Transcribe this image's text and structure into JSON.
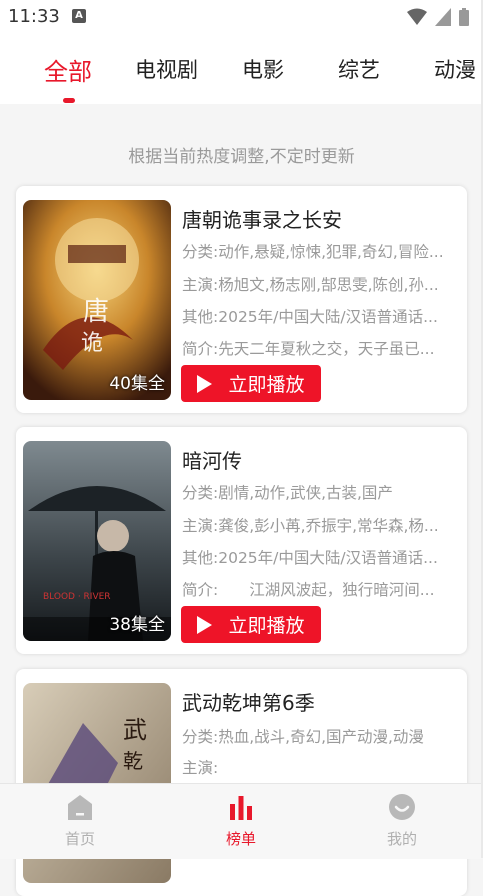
{
  "status_bar": {
    "time": "11:33",
    "notification_icon": "A"
  },
  "tabs": [
    {
      "label": "全部",
      "active": true
    },
    {
      "label": "电视剧",
      "active": false
    },
    {
      "label": "电影",
      "active": false
    },
    {
      "label": "综艺",
      "active": false
    },
    {
      "label": "动漫",
      "active": false
    }
  ],
  "subtitle": "根据当前热度调整,不定时更新",
  "items": [
    {
      "title": "唐朝诡事录之长安",
      "episodes": "40集全",
      "category": "分类:动作,悬疑,惊悚,犯罪,奇幻,冒险...",
      "cast": "主演:杨旭文,杨志刚,郜思雯,陈创,孙...",
      "other": "其他:2025年/中国大陆/汉语普通话...",
      "intro": "简介:先天二年夏秋之交，天子虽已...",
      "play_label": "立即播放"
    },
    {
      "title": "暗河传",
      "episodes": "38集全",
      "category": "分类:剧情,动作,武侠,古装,国产",
      "cast": "主演:龚俊,彭小苒,乔振宇,常华森,杨...",
      "other": "其他:2025年/中国大陆/汉语普通话...",
      "intro": "简介:　　江湖风波起，独行暗河间...",
      "play_label": "立即播放"
    },
    {
      "title": "武动乾坤第6季",
      "category": "分类:热血,战斗,奇幻,国产动漫,动漫",
      "cast": "主演:"
    }
  ],
  "bottom_nav": [
    {
      "label": "首页",
      "icon": "home-icon",
      "active": false
    },
    {
      "label": "榜单",
      "icon": "chart-icon",
      "active": true
    },
    {
      "label": "我的",
      "icon": "profile-icon",
      "active": false
    }
  ],
  "colors": {
    "accent": "#e8182b",
    "button": "#ee1428"
  }
}
